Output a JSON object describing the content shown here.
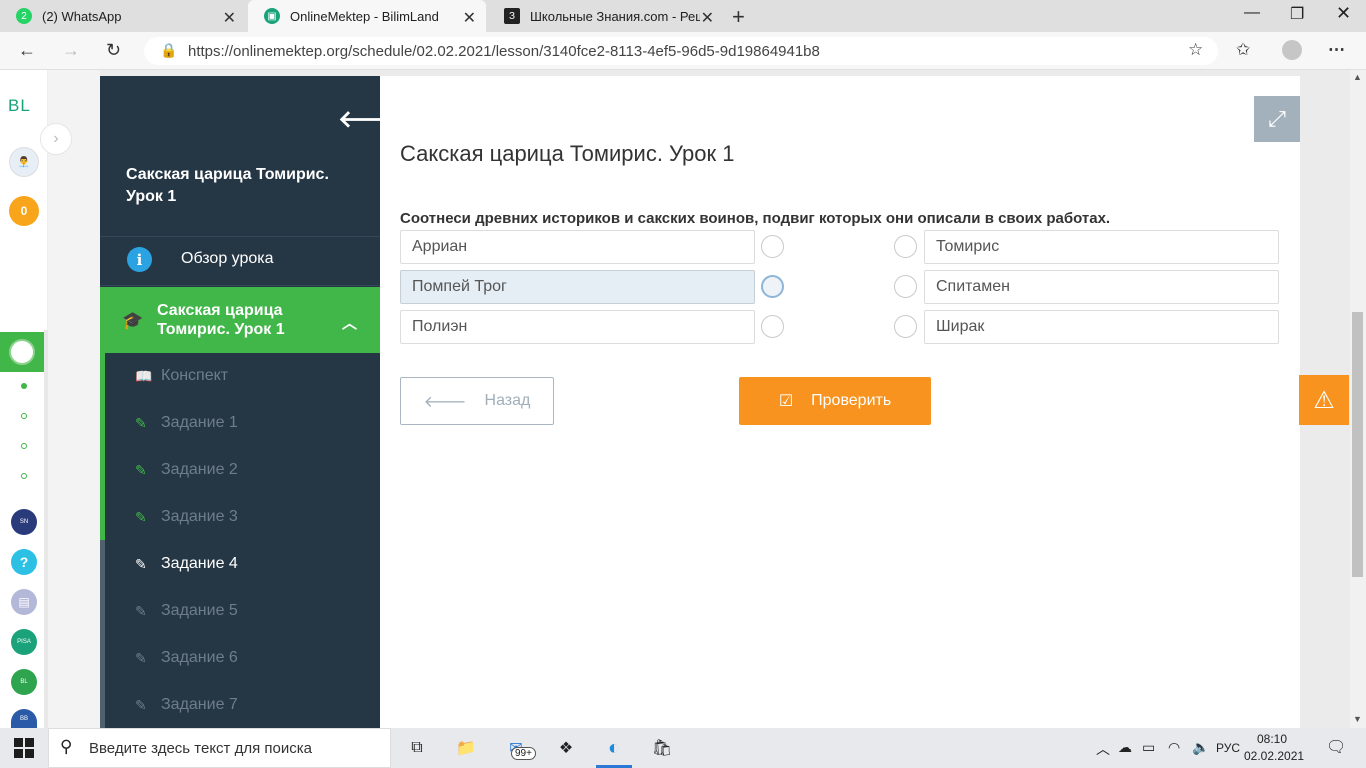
{
  "browser": {
    "tabs": [
      {
        "title": "(2) WhatsApp",
        "badge": "2",
        "favicon_color": "#25d366"
      },
      {
        "title": "OnlineMektep - BilimLand",
        "favicon_color": "#1aa37a"
      },
      {
        "title": "Школьные Знания.com - Решае",
        "badge": "З",
        "favicon_color": "#222222"
      }
    ],
    "new_tab": "+",
    "url": "https://onlinemektep.org/schedule/02.02.2021/lesson/3140fce2-8113-4ef5-96d5-9d19864941b8"
  },
  "rail": {
    "logo": "BL",
    "coins": "0",
    "help": "?"
  },
  "sidebar": {
    "title": "Сакская царица Томирис. Урок 1",
    "overview": "Обзор урока",
    "active_section": "Сакская царица Томирис. Урок 1",
    "items": [
      {
        "label": "Конспект"
      },
      {
        "label": "Задание 1"
      },
      {
        "label": "Задание 2"
      },
      {
        "label": "Задание 3"
      },
      {
        "label": "Задание 4"
      },
      {
        "label": "Задание 5"
      },
      {
        "label": "Задание 6"
      },
      {
        "label": "Задание 7"
      }
    ]
  },
  "main": {
    "title": "Сакская царица Томирис. Урок 1",
    "question": "Соотнеси древних историков и сакских воинов, подвиг которых они описали в своих работах.",
    "left_items": [
      "Арриан",
      "Помпей Трог",
      "Полиэн"
    ],
    "right_items": [
      "Томирис",
      "Спитамен",
      "Ширак"
    ],
    "back_label": "Назад",
    "check_label": "Проверить"
  },
  "taskbar": {
    "search_placeholder": "Введите здесь текст для поиска",
    "mail_badge": "99+",
    "lang": "РУС",
    "time": "08:10",
    "date": "02.02.2021"
  },
  "colors": {
    "sidebar_bg": "#253645",
    "accent_green": "#41b649",
    "accent_orange": "#f7931e"
  }
}
